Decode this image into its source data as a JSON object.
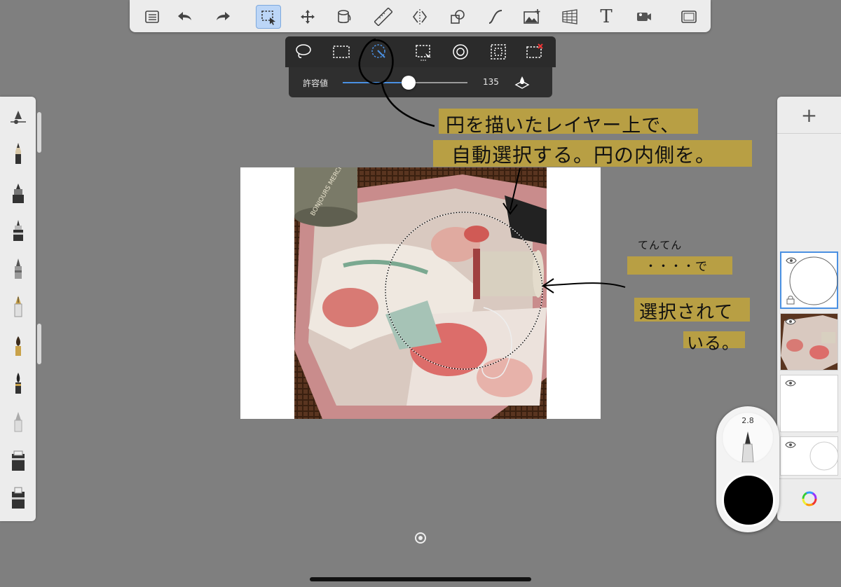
{
  "toolbar": {
    "tools": [
      {
        "icon": "list-icon"
      },
      {
        "icon": "undo-icon"
      },
      {
        "icon": "redo-icon"
      },
      {
        "icon": "selection-icon",
        "active": true
      },
      {
        "icon": "transform-icon"
      },
      {
        "icon": "fill-icon"
      },
      {
        "icon": "ruler-icon"
      },
      {
        "icon": "symmetry-icon"
      },
      {
        "icon": "shape-icon"
      },
      {
        "icon": "curve-icon"
      },
      {
        "icon": "add-image-icon"
      },
      {
        "icon": "perspective-icon"
      },
      {
        "icon": "text-icon",
        "glyph": "T"
      },
      {
        "icon": "video-icon"
      },
      {
        "icon": "fullscreen-icon"
      }
    ]
  },
  "selection_bar": {
    "modes": [
      "lasso-icon",
      "rect-select-icon",
      "magic-wand-icon",
      "selection-transform-icon",
      "circle-select-icon",
      "invert-select-icon",
      "clear-select-icon"
    ],
    "tolerance_label": "許容値",
    "tolerance_value": "135",
    "tolerance_fraction": 0.53
  },
  "annotations": {
    "line1": "円を描いたレイヤー上で、",
    "line2": "自動選択する。円の内側を。",
    "note_small": "てんてん",
    "note_dots": "・・・・で",
    "note_line1": "選択されて",
    "note_line2": "いる。"
  },
  "photo": {
    "label_text": "BONJOURS MERCI"
  },
  "layers": {
    "add_label": "+"
  },
  "brush_puck": {
    "size": "2.8",
    "color": "#000000"
  },
  "colors": {
    "accent": "#4a90e2",
    "highlight": "#c2a539",
    "toolbar_bg": "#ececec",
    "workspace_bg": "#7f7f7f"
  }
}
